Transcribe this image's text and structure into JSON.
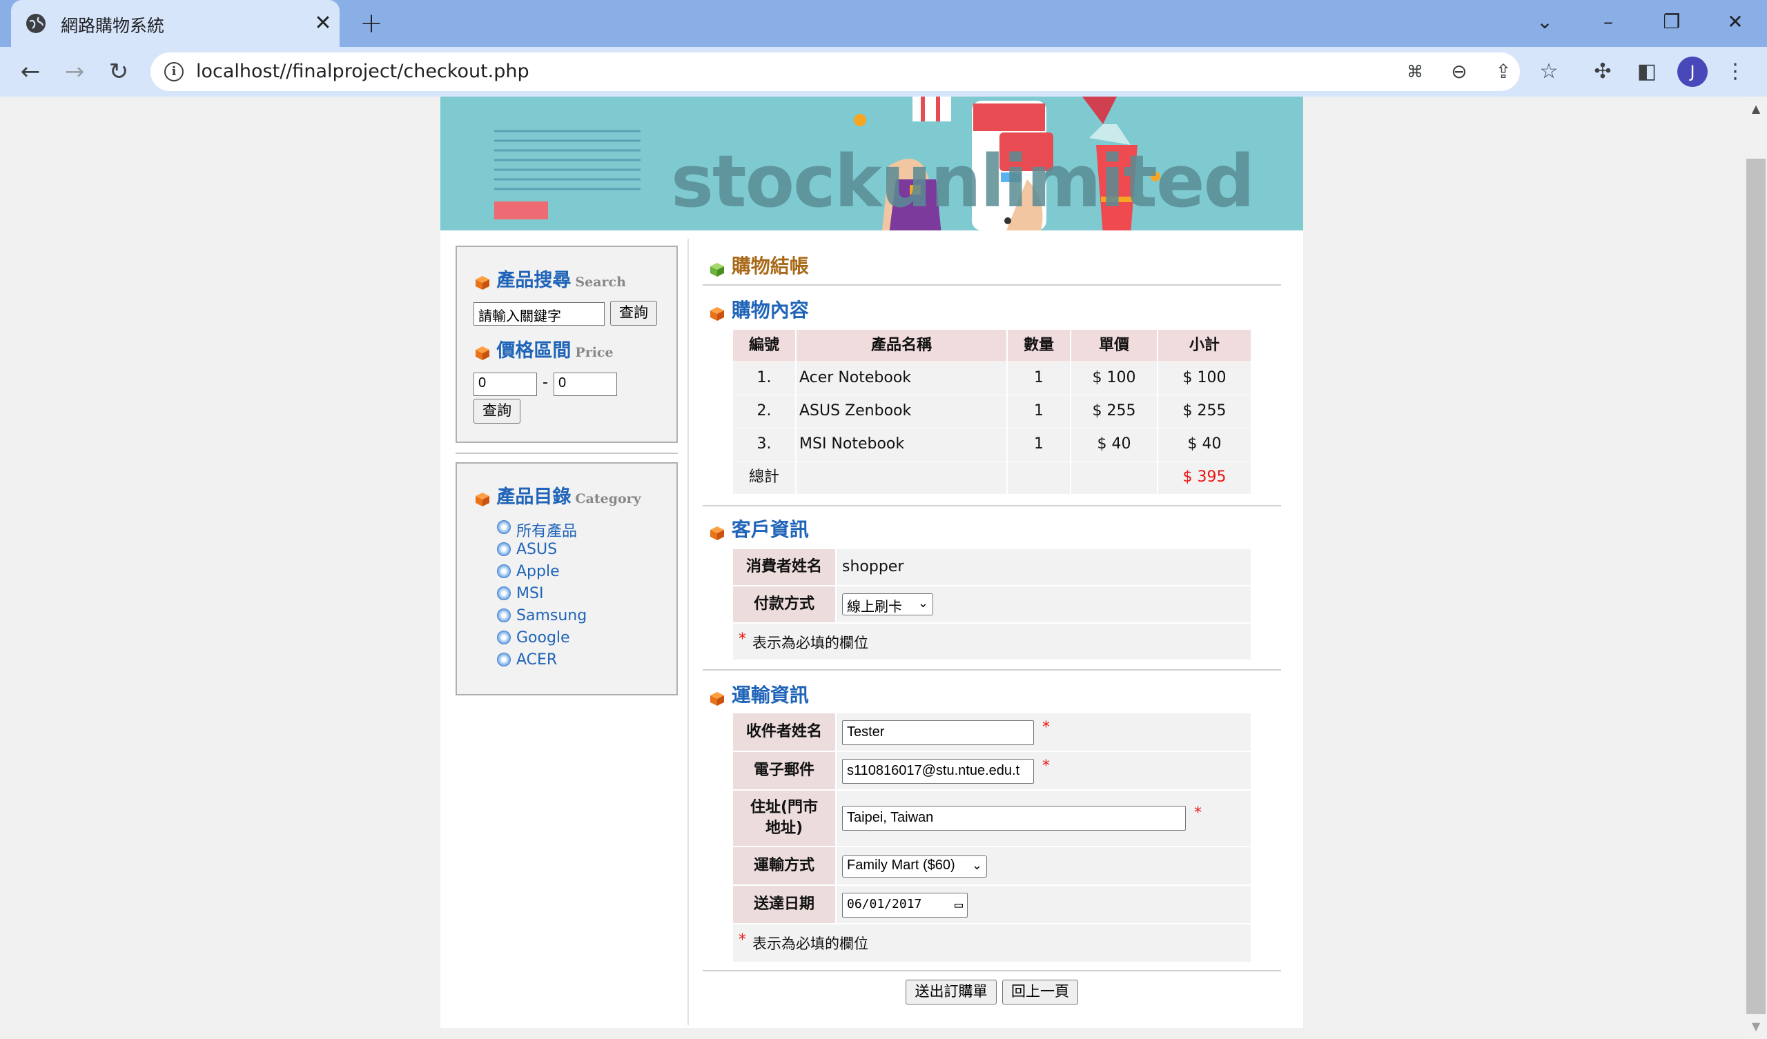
{
  "browser": {
    "tab_title": "網路購物系統",
    "url": "localhost//finalproject/checkout.php",
    "profile_initial": "J"
  },
  "banner": {
    "logo_text": "stockunlimited"
  },
  "sidebar": {
    "search": {
      "title": "產品搜尋",
      "title_en": "Search",
      "placeholder": "請輸入關鍵字",
      "button": "查詢"
    },
    "price": {
      "title": "價格區間",
      "title_en": "Price",
      "min": "0",
      "sep": "-",
      "max": "0",
      "button": "查詢"
    },
    "category": {
      "title": "產品目錄",
      "title_en": "Category",
      "items": [
        "所有產品",
        "ASUS",
        "Apple",
        "MSI",
        "Samsung",
        "Google",
        "ACER"
      ]
    }
  },
  "main": {
    "title": "購物結帳",
    "cart": {
      "title": "購物內容",
      "headers": [
        "編號",
        "產品名稱",
        "數量",
        "單價",
        "小計"
      ],
      "rows": [
        {
          "no": "1.",
          "name": "Acer Notebook",
          "qty": "1",
          "price": "$ 100",
          "subtotal": "$ 100"
        },
        {
          "no": "2.",
          "name": "ASUS Zenbook",
          "qty": "1",
          "price": "$ 255",
          "subtotal": "$ 255"
        },
        {
          "no": "3.",
          "name": "MSI Notebook",
          "qty": "1",
          "price": "$ 40",
          "subtotal": "$ 40"
        }
      ],
      "total_label": "總計",
      "total_value": "$ 395"
    },
    "customer": {
      "title": "客戶資訊",
      "name_label": "消費者姓名",
      "name_value": "shopper",
      "payment_label": "付款方式",
      "payment_value": "線上刷卡",
      "required_mark": "*",
      "required_note": "表示為必填的欄位"
    },
    "shipping": {
      "title": "運輸資訊",
      "recipient_label": "收件者姓名",
      "recipient_value": "Tester",
      "email_label": "電子郵件",
      "email_value": "s110816017@stu.ntue.edu.t",
      "address_label": "住址(門市地址)",
      "address_value": "Taipei, Taiwan",
      "method_label": "運輸方式",
      "method_value": "Family Mart ($60)",
      "date_label": "送達日期",
      "date_value": "06/01/2017",
      "required_mark": "*",
      "required_note": "表示為必填的欄位"
    },
    "buttons": {
      "submit": "送出訂購單",
      "back": "回上一頁"
    }
  },
  "colors": {
    "section_blue": "#1f64b8",
    "title_brown": "#a86a1a",
    "total_red": "#ee1111",
    "header_pink": "#f0dcdc"
  }
}
